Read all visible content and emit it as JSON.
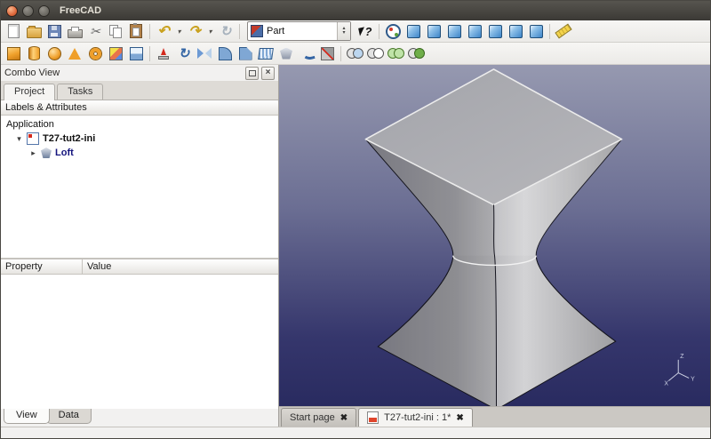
{
  "window": {
    "title": "FreeCAD"
  },
  "toolbar_file": {
    "icons": [
      "new-file-icon",
      "open-folder-icon",
      "save-icon",
      "print-icon",
      "cut-icon",
      "copy-icon",
      "paste-icon",
      "undo-icon",
      "undo-dropdown-icon",
      "redo-icon",
      "redo-dropdown-icon",
      "refresh-icon",
      "whats-this-icon"
    ]
  },
  "workbench": {
    "selected": "Part"
  },
  "toolbar_view": {
    "icons": [
      "fit-all-icon",
      "axonometric-view-icon",
      "front-view-icon",
      "top-view-icon",
      "right-view-icon",
      "rear-view-icon",
      "bottom-view-icon",
      "left-view-icon",
      "measure-distance-icon"
    ]
  },
  "toolbar_part": {
    "icons": [
      "box-icon",
      "cylinder-icon",
      "sphere-icon",
      "cone-icon",
      "torus-icon",
      "create-primitives-icon",
      "shape-builder-icon",
      "extrude-icon",
      "revolve-icon",
      "mirror-icon",
      "fillet-icon",
      "chamfer-icon",
      "ruled-surface-icon",
      "loft-icon",
      "sweep-icon",
      "section-icon",
      "boolean-icon",
      "cut-icon",
      "union-icon",
      "intersection-icon"
    ]
  },
  "combo_view": {
    "title": "Combo View",
    "tabs": {
      "project": "Project",
      "tasks": "Tasks"
    },
    "labels_header": "Labels & Attributes",
    "tree": {
      "root": "Application",
      "document": "T27-tut2-ini",
      "feature": "Loft"
    },
    "properties": {
      "col_property": "Property",
      "col_value": "Value"
    },
    "bottom_tabs": {
      "view": "View",
      "data": "Data"
    }
  },
  "mdi": {
    "tabs": [
      {
        "label": "Start page"
      },
      {
        "label": "T27-tut2-ini : 1*"
      }
    ],
    "close_glyph": "✖"
  },
  "viewport": {
    "axis": {
      "x": "X",
      "y": "Y",
      "z": "Z"
    }
  }
}
